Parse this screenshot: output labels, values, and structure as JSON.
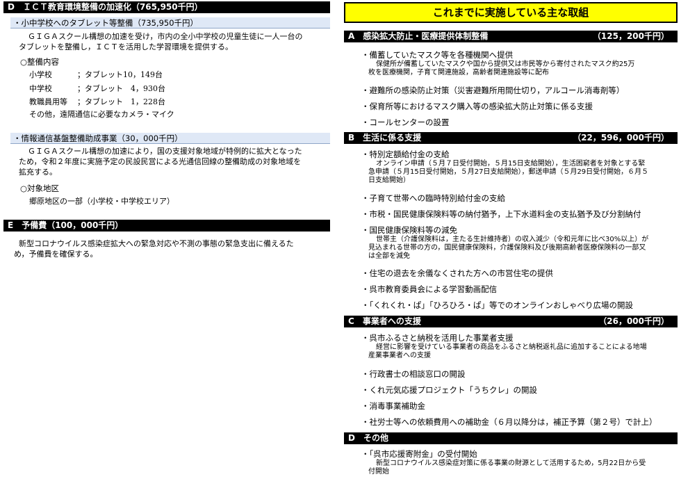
{
  "left": {
    "sectionD": {
      "title": "D　ＩＣＴ教育環境整備の加速化（765,950千円）",
      "sub1": {
        "title": "・小中学校へのタブレット等整備（735,950千円）",
        "body": [
          "ＧＩＧＡスクール構想の加速を受け，市内の全小中学校の児童生徒に一人一台の",
          "タブレットを整備し，ＩＣＴを活用した学習環境を提供する。"
        ],
        "contents_heading": "○整備内容",
        "rows": [
          {
            "label": "小学校",
            "value": "；タブレット10，149台"
          },
          {
            "label": "中学校",
            "value": "；タブレット　4，930台"
          },
          {
            "label": "教職員用等",
            "value": "；タブレット　1，228台"
          }
        ],
        "other": "その他，遠隔通信に必要なカメラ・マイク"
      },
      "sub2": {
        "title": "・情報通信基盤整備助成事業（30，000千円）",
        "body": [
          "ＧＩＧＡスクール構想の加速により，国の支援対象地域が特例的に拡大となった",
          "ため，令和２年度に実施予定の民設民営による光通信回線の整備助成の対象地域を",
          "拡充する。"
        ],
        "area_heading": "○対象地区",
        "area": "郷原地区の一部（小学校・中学校エリア）"
      }
    },
    "sectionE": {
      "title": "E　予備費（100，000千円）",
      "body": [
        "新型コロナウイルス感染症拡大への緊急対応や不測の事態の緊急支出に備えるた",
        "め，予備費を確保する。"
      ]
    }
  },
  "right": {
    "banner": "これまでに実施している主な取組",
    "sections": [
      {
        "letter": "A",
        "title": "感染拡大防止・医療提供体制整備",
        "amount": "（125，200千円）",
        "items": [
          {
            "text": "・備蓄していたマスク等を各種機関へ提供",
            "sub": [
              "保健所が備蓄していたマスクや国から提供又は市民等から寄付されたマスク約25万",
              "枚を医療機関，子育て関連施設，高齢者関連施設等に配布"
            ]
          },
          {
            "text": "・避難所の感染防止対策（災害避難所用間仕切り，アルコール消毒剤等）"
          },
          {
            "text": "・保育所等におけるマスク購入等の感染拡大防止対策に係る支援"
          },
          {
            "text": "・コールセンターの設置"
          }
        ]
      },
      {
        "letter": "B",
        "title": "生活に係る支援",
        "amount": "（22，596，000千円）",
        "items": [
          {
            "text": "・特別定額給付金の支給",
            "sub": [
              "オンライン申請（５月７日受付開始，５月15日支給開始），生活困窮者を対象とする緊",
              "急申請（５月15日受付開始，５月27日支給開始），郵送申請（５月29日受付開始，６月５",
              "日支給開始）"
            ]
          },
          {
            "text": "・子育て世帯への臨時特別給付金の支給"
          },
          {
            "text": "・市税・国民健康保険料等の納付猶予，上下水道料金の支払猶予及び分割納付"
          },
          {
            "text": "・国民健康保険料等の減免",
            "sub": [
              "世帯主（介護保険料は，主たる生計維持者）の収入減少（令和元年に比べ30%以上）が",
              "見込まれる世帯の方の，国民健康保険料，介護保険料及び後期高齢者医療保険料の一部又",
              "は全部を減免"
            ]
          },
          {
            "text": "・住宅の退去を余儀なくされた方への市営住宅の提供"
          },
          {
            "text": "・呉市教育委員会による学習動画配信"
          },
          {
            "text": "・「くれくれ・ぱ」「ひろひろ・ぱ」等でのオンラインおしゃべり広場の開設"
          }
        ]
      },
      {
        "letter": "C",
        "title": "事業者への支援",
        "amount": "（26，000千円）",
        "items": [
          {
            "text": "・呉市ふるさと納税を活用した事業者支援",
            "sub": [
              "経営に影響を受けている事業者の商品をふるさと納税返礼品に追加することによる地場",
              "産業事業者への支援"
            ]
          },
          {
            "text": "・行政書士の相談窓口の開設"
          },
          {
            "text": "・くれ元気応援プロジェクト「うちクレ」の開設"
          },
          {
            "text": "・消毒事業補助金"
          },
          {
            "text": "・社労士等への依頼費用への補助金（６月以降分は，補正予算（第２号）で計上）"
          }
        ]
      },
      {
        "letter": "D",
        "title": "その他",
        "amount": "",
        "items": [
          {
            "text": "・「呉市応援寄附金」の受付開始",
            "sub": [
              "新型コロナウイルス感染症対策に係る事業の財源として活用するため，5月22日から受",
              "付開始"
            ]
          }
        ]
      }
    ]
  }
}
